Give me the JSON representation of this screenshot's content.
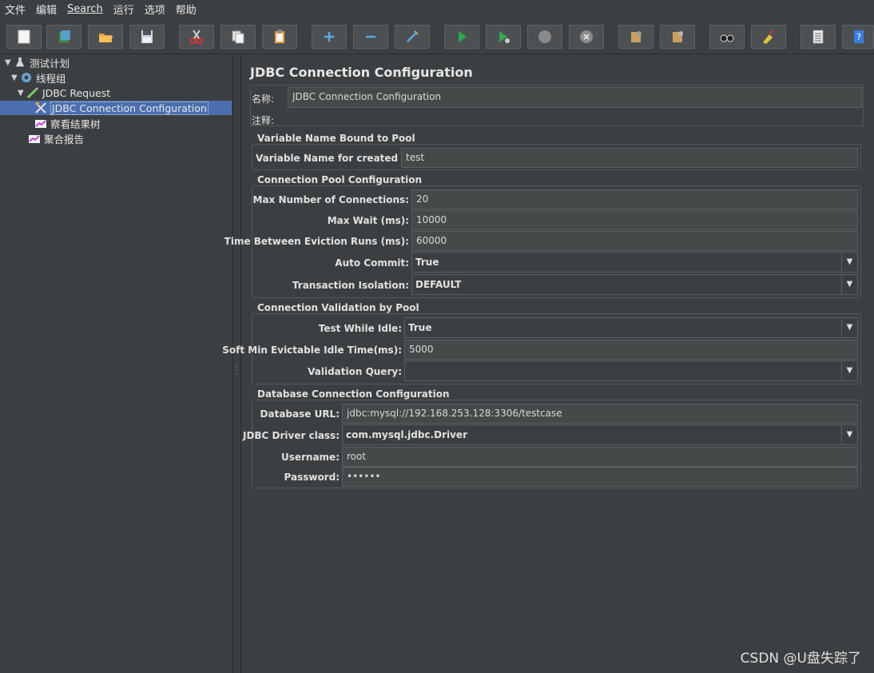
{
  "menu": [
    "文件",
    "编辑",
    "Search",
    "运行",
    "选项",
    "帮助"
  ],
  "tree": [
    {
      "label": "测试计划"
    },
    {
      "label": "线程组"
    },
    {
      "label": "JDBC Request"
    },
    {
      "label": "JDBC Connection Configuration"
    },
    {
      "label": "察看结果树"
    },
    {
      "label": "聚合报告"
    }
  ],
  "panel": {
    "title": "JDBC Connection Configuration",
    "name_label": "名称:",
    "name_value": "JDBC Connection Configuration",
    "comment_label": "注释:",
    "comment_value": ""
  },
  "groups": {
    "pool_var": {
      "title": "Variable Name Bound to Pool",
      "var_label": "Variable Name for created pool:",
      "var_value": "test"
    },
    "pool_cfg": {
      "title": "Connection Pool Configuration",
      "max_conn_label": "Max Number of Connections:",
      "max_conn_value": "20",
      "max_wait_label": "Max Wait (ms):",
      "max_wait_value": "10000",
      "eviction_label": "Time Between Eviction Runs (ms):",
      "eviction_value": "60000",
      "auto_commit_label": "Auto Commit:",
      "auto_commit_value": "True",
      "isolation_label": "Transaction Isolation:",
      "isolation_value": "DEFAULT"
    },
    "validation": {
      "title": "Connection Validation by Pool",
      "idle_label": "Test While Idle:",
      "idle_value": "True",
      "soft_min_label": "Soft Min Evictable Idle Time(ms):",
      "soft_min_value": "5000",
      "query_label": "Validation Query:",
      "query_value": ""
    },
    "db": {
      "title": "Database Connection Configuration",
      "url_label": "Database URL:",
      "url_value": "jdbc:mysql://192.168.253.128:3306/testcase",
      "driver_label": "JDBC Driver class:",
      "driver_value": "com.mysql.jdbc.Driver",
      "user_label": "Username:",
      "user_value": "root",
      "pass_label": "Password:",
      "pass_value": "••••••"
    }
  },
  "watermark": "CSDN @U盘失踪了"
}
